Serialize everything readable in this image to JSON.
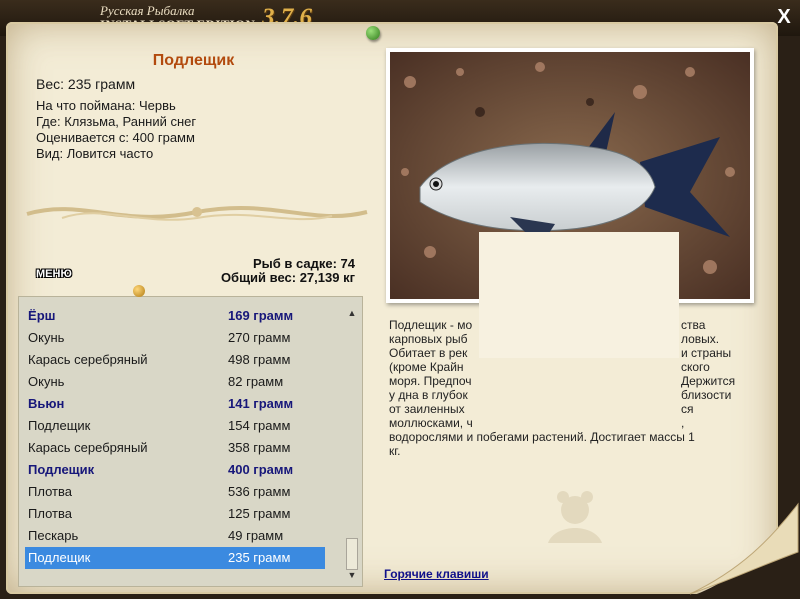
{
  "header": {
    "brand_line1": "Русская Рыбалка",
    "brand_line2": "INSTALLSOFT EDITION",
    "version": "3.7.6",
    "close": "X"
  },
  "fish": {
    "name": "Подлещик",
    "weight": "Вес: 235 грамм",
    "bait": "На что поймана: Червь",
    "location": "Где: Клязьма, Ранний снег",
    "value": "Оценивается с: 400 грамм",
    "frequency": "Вид: Ловится часто"
  },
  "menu_label": "МЕНЮ",
  "stats": {
    "count": "Рыб в садке: 74",
    "total": "Общий вес: 27,139 кг"
  },
  "catch_list": [
    {
      "name": "Ёрш",
      "weight": "169 грамм",
      "best": true
    },
    {
      "name": "Окунь",
      "weight": "270 грамм",
      "best": false
    },
    {
      "name": "Карась серебряный",
      "weight": "498 грамм",
      "best": false
    },
    {
      "name": "Окунь",
      "weight": "82 грамм",
      "best": false
    },
    {
      "name": "Вьюн",
      "weight": "141 грамм",
      "best": true
    },
    {
      "name": "Подлещик",
      "weight": "154 грамм",
      "best": false
    },
    {
      "name": "Карась серебряный",
      "weight": "358 грамм",
      "best": false
    },
    {
      "name": "Подлещик",
      "weight": "400 грамм",
      "best": true
    },
    {
      "name": "Плотва",
      "weight": "536 грамм",
      "best": false
    },
    {
      "name": "Плотва",
      "weight": "125 грамм",
      "best": false
    },
    {
      "name": "Пескарь",
      "weight": "49 грамм",
      "best": false
    },
    {
      "name": "Подлещик",
      "weight": "235 грамм",
      "best": false,
      "selected": true
    }
  ],
  "description": [
    "Подлещик - мо",
    "карповых рыб",
    "Обитает в рек",
    "(кроме Крайн",
    "моря. Предпоч",
    "у дна в глубок",
    "от заиленных",
    "моллюсками, ч",
    "водорослями и побегами растений. Достигает массы 1",
    "кг."
  ],
  "description_right": [
    "ства",
    "ловых.",
    "и страны",
    "ского",
    "Держится",
    "близости",
    "ся",
    ","
  ],
  "hotkeys": "Горячие клавиши",
  "colors": {
    "paper": "#f3ecd6",
    "title": "#b24a0e",
    "best_row": "#17177a",
    "selection": "#3b8ae0",
    "link": "#10108a"
  }
}
